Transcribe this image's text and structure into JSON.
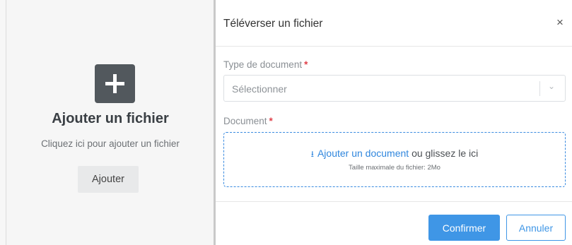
{
  "left_panel": {
    "title": "Ajouter un fichier",
    "subtitle": "Cliquez ici pour ajouter un fichier",
    "add_button_label": "Ajouter",
    "plus_icon": "plus-icon"
  },
  "modal": {
    "title": "Téléverser un fichier",
    "close_label": "×",
    "document_type": {
      "label": "Type de document",
      "required_mark": "*",
      "placeholder": "Sélectionner",
      "chevron": "⌄"
    },
    "document": {
      "label": "Document",
      "required_mark": "*",
      "upload_icon": "⭳",
      "link_text": "Ajouter un document",
      "trailing_text": "ou glissez le ici",
      "max_size_text": "Taille maximale du fichier: 2Mo"
    },
    "confirm_label": "Confirmer",
    "cancel_label": "Annuler"
  },
  "colors": {
    "accent": "#3f96e6",
    "required": "#e0414a",
    "plus_box": "#52585d"
  }
}
